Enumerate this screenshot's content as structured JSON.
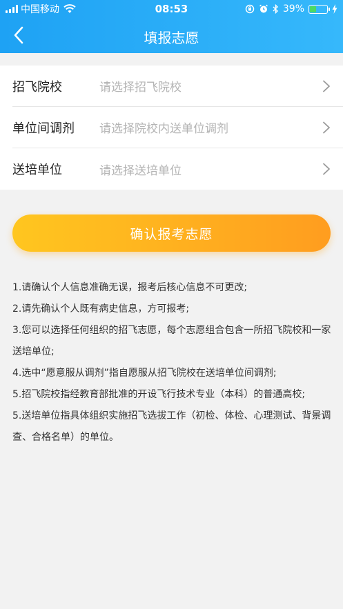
{
  "status_bar": {
    "carrier": "中国移动",
    "time": "08:53",
    "battery_percent": "39%",
    "battery_level": 0.39
  },
  "nav": {
    "title": "填报志愿",
    "back_icon": "chevron-left-icon"
  },
  "form": {
    "rows": [
      {
        "label": "招飞院校",
        "placeholder": "请选择招飞院校"
      },
      {
        "label": "单位间调剂",
        "placeholder": "请选择院校内送单位调剂"
      },
      {
        "label": "送培单位",
        "placeholder": "请选择送培单位"
      }
    ]
  },
  "confirm_button": {
    "label": "确认报考志愿"
  },
  "notes": [
    "1.请确认个人信息准确无误，报考后核心信息不可更改;",
    "2.请先确认个人既有病史信息，方可报考;",
    "3.您可以选择任何组织的招飞志愿，每个志愿组合包含一所招飞院校和一家送培单位;",
    "4.选中“愿意服从调剂”指自愿服从招飞院校在送培单位间调剂;",
    "5.招飞院校指经教育部批准的开设飞行技术专业（本科）的普通高校;",
    "5.送培单位指具体组织实施招飞选拔工作（初检、体检、心理测试、背景调查、合格名单）的单位。"
  ],
  "colors": {
    "header_start": "#1ea2f4",
    "header_end": "#36b8fb",
    "button_start": "#ffc61f",
    "button_end": "#ff9d1f",
    "battery_fill": "#4cd964"
  }
}
